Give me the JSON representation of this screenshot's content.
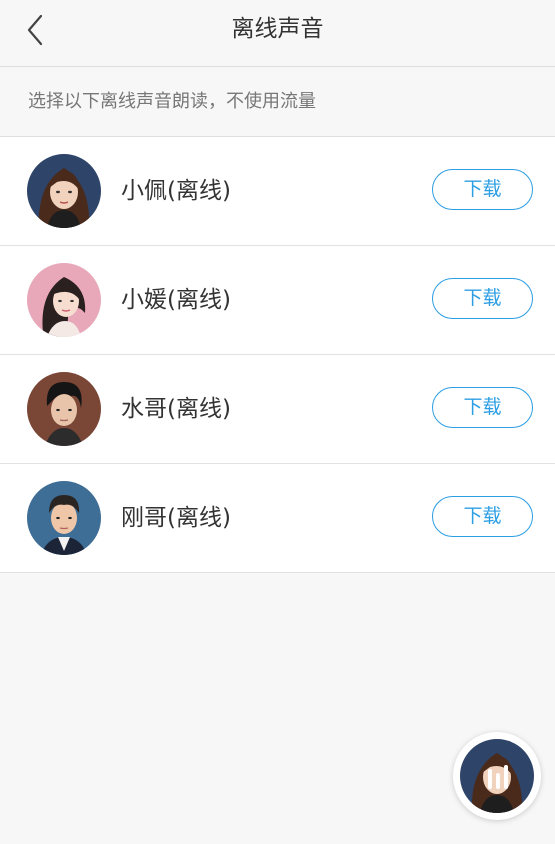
{
  "header": {
    "title": "离线声音",
    "back_icon": "chevron-left-icon"
  },
  "subtitle": "选择以下离线声音朗读，不使用流量",
  "voices": [
    {
      "name": "小佩(离线)",
      "action": "下载"
    },
    {
      "name": "小媛(离线)",
      "action": "下载"
    },
    {
      "name": "水哥(离线)",
      "action": "下载"
    },
    {
      "name": "刚哥(离线)",
      "action": "下载"
    }
  ],
  "floating_player": {
    "icon": "audio-bars-icon"
  },
  "colors": {
    "accent": "#2c9ee3",
    "background": "#f7f7f7"
  }
}
